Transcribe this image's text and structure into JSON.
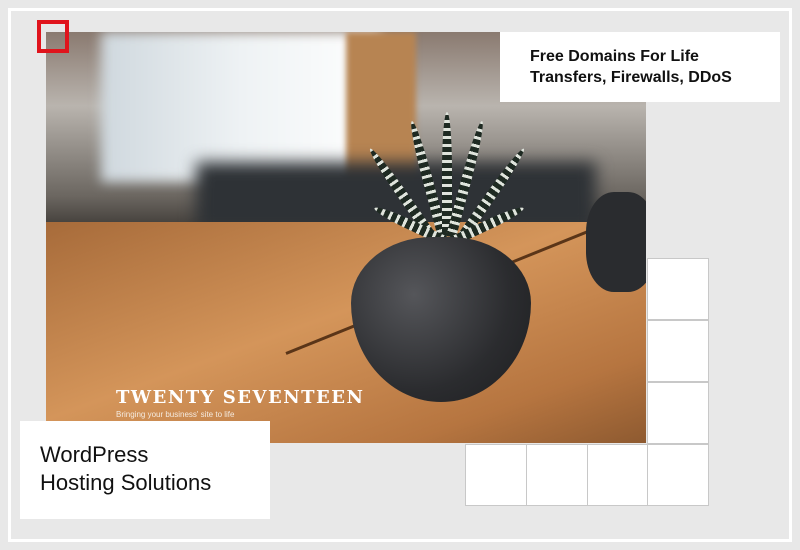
{
  "photo": {
    "theme_title": "TWENTY SEVENTEEN",
    "theme_tagline": "Bringing your business' site to life"
  },
  "promo_top": {
    "line1": "Free Domains For Life",
    "line2": "Transfers, Firewalls, DDoS"
  },
  "promo_bottom": {
    "line1": "WordPress",
    "line2": "Hosting Solutions"
  },
  "colors": {
    "accent_red": "#e0141c",
    "background": "#e8e8e8"
  }
}
